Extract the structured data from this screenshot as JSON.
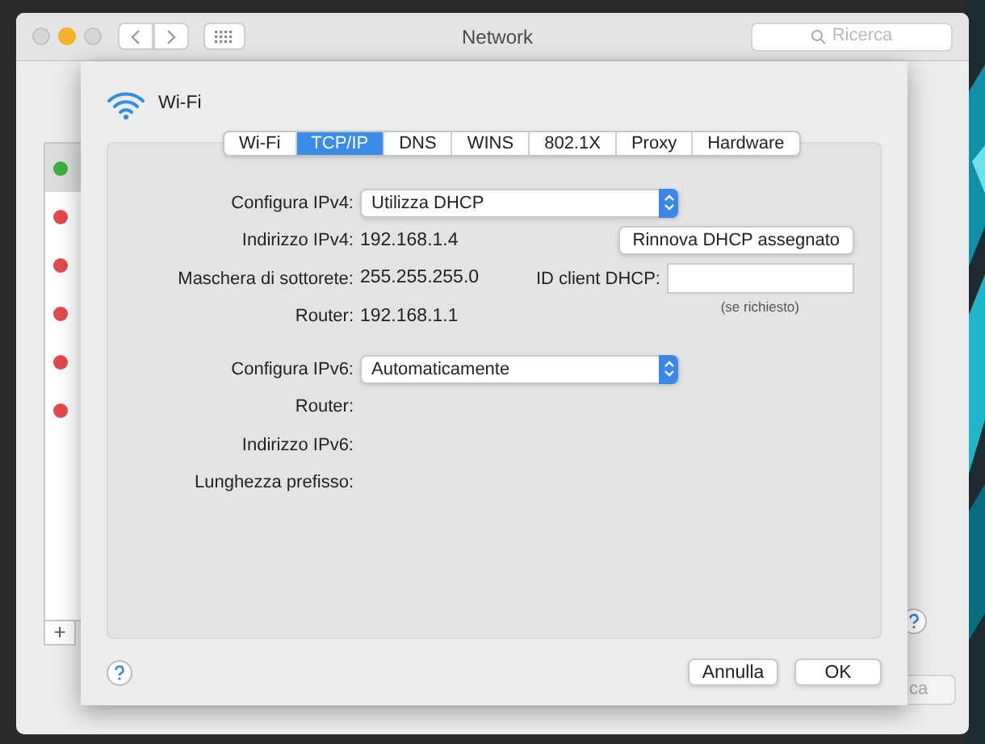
{
  "window": {
    "title": "Network",
    "search_placeholder": "Ricerca"
  },
  "sidebar": {
    "items": [
      {
        "color": "#3cb043",
        "selected": true
      },
      {
        "color": "#e5484d",
        "selected": false
      },
      {
        "color": "#e5484d",
        "selected": false
      },
      {
        "color": "#e5484d",
        "selected": false
      },
      {
        "color": "#e5484d",
        "selected": false
      },
      {
        "color": "#e5484d",
        "selected": false
      }
    ],
    "add_button": "+"
  },
  "apply_button": "ca",
  "sheet": {
    "service": "Wi-Fi",
    "tabs": [
      {
        "label": "Wi-Fi",
        "selected": false
      },
      {
        "label": "TCP/IP",
        "selected": true
      },
      {
        "label": "DNS",
        "selected": false
      },
      {
        "label": "WINS",
        "selected": false
      },
      {
        "label": "802.1X",
        "selected": false
      },
      {
        "label": "Proxy",
        "selected": false
      },
      {
        "label": "Hardware",
        "selected": false
      }
    ],
    "ipv4_fields": [
      {
        "kind": "popup",
        "label": "Configura IPv4:",
        "value": "Utilizza DHCP"
      },
      {
        "kind": "text",
        "label": "Indirizzo IPv4:",
        "value": "192.168.1.4",
        "action": "Rinnova DHCP assegnato"
      },
      {
        "kind": "text",
        "label": "Maschera di sottorete:",
        "value": "255.255.255.0",
        "side_field": {
          "label": "ID client DHCP:",
          "hint": "(se richiesto)"
        }
      },
      {
        "kind": "text",
        "label": "Router:",
        "value": "192.168.1.1"
      }
    ],
    "ipv6_fields": [
      {
        "kind": "popup",
        "label": "Configura IPv6:",
        "value": "Automaticamente"
      },
      {
        "kind": "empty",
        "label": "Router:"
      },
      {
        "kind": "empty",
        "label": "Indirizzo IPv6:"
      },
      {
        "kind": "empty",
        "label": "Lunghezza prefisso:"
      }
    ],
    "buttons": [
      "Annulla",
      "OK"
    ]
  }
}
